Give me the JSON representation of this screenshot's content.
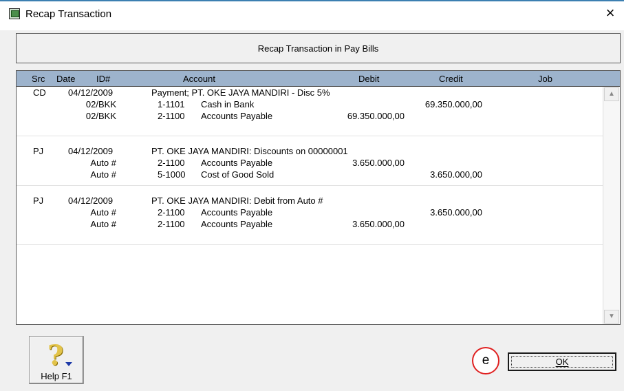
{
  "window": {
    "title": "Recap Transaction",
    "close_glyph": "×"
  },
  "header_panel": {
    "text": "Recap Transaction in Pay Bills"
  },
  "table": {
    "columns": [
      "Src",
      "Date",
      "ID#",
      "Account",
      "Debit",
      "Credit",
      "Job"
    ],
    "groups": [
      {
        "src": "CD",
        "date": "04/12/2009",
        "memo": "Payment; PT. OKE JAYA MANDIRI - Disc 5%",
        "lines": [
          {
            "id": "02/BKK",
            "acct_no": "1-1101",
            "acct_name": "Cash in Bank",
            "debit": "",
            "credit": "69.350.000,00"
          },
          {
            "id": "02/BKK",
            "acct_no": "2-1100",
            "acct_name": "Accounts Payable",
            "debit": "69.350.000,00",
            "credit": ""
          }
        ]
      },
      {
        "src": "PJ",
        "date": "04/12/2009",
        "memo": "PT. OKE JAYA MANDIRI:  Discounts on 00000001",
        "lines": [
          {
            "id": "Auto #",
            "acct_no": "2-1100",
            "acct_name": "Accounts Payable",
            "debit": "3.650.000,00",
            "credit": ""
          },
          {
            "id": "Auto #",
            "acct_no": "5-1000",
            "acct_name": "Cost of Good Sold",
            "debit": "",
            "credit": "3.650.000,00"
          }
        ]
      },
      {
        "src": "PJ",
        "date": "04/12/2009",
        "memo": "PT. OKE JAYA MANDIRI:  Debit from Auto #",
        "lines": [
          {
            "id": "Auto #",
            "acct_no": "2-1100",
            "acct_name": "Accounts Payable",
            "debit": "",
            "credit": "3.650.000,00"
          },
          {
            "id": "Auto #",
            "acct_no": "2-1100",
            "acct_name": "Accounts Payable",
            "debit": "3.650.000,00",
            "credit": ""
          }
        ]
      }
    ]
  },
  "scrollbar": {
    "up_icon": "scroll-up-arrow",
    "down_icon": "scroll-down-arrow",
    "up_glyph": "▲",
    "down_glyph": "▼"
  },
  "help_button": {
    "label": "Help F1",
    "glyph": "?"
  },
  "ok_button": {
    "label": "OK"
  },
  "annotation": {
    "label": "e",
    "color": "#e02020"
  },
  "colors": {
    "header_bg": "#9db3cc",
    "window_bg": "#f0f0f0"
  }
}
